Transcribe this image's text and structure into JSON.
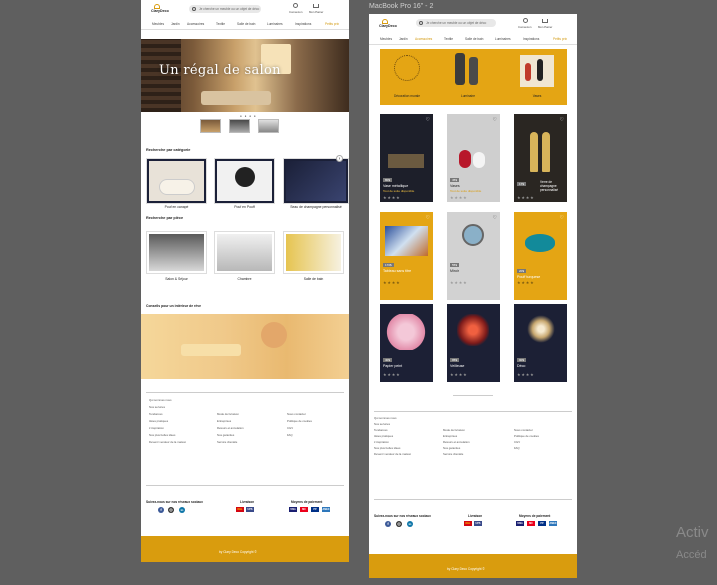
{
  "frame_title": "MacBook Pro 16\" - 2",
  "watermark": {
    "line1": "Activ",
    "line2": "Accéd"
  },
  "brand": "ClaryDeco",
  "search_placeholder": "Je cherche un meuble ou un objet de déco",
  "header": {
    "account": "Connexion",
    "cart": "Mon Panier"
  },
  "nav": [
    "Meubles",
    "Jardin",
    "Accessoires",
    "Textile",
    "Salle de bain",
    "Luminaires",
    "Inspirations",
    "Petits prix"
  ],
  "mobile": {
    "hero_title": "Un régal de salon",
    "dots": "● ● ● ●",
    "section_category": "Recherche par catégorie",
    "categories": [
      "Pouf en canapé",
      "Pouf en Pouff",
      "Seau de champagne personnalisé"
    ],
    "section_room": "Recherche par pièce",
    "rooms": [
      "Salon & Séjour",
      "Chambre",
      "Salle de bain"
    ],
    "promo_title": "Conseils pour un intérieur de rêve"
  },
  "desktop": {
    "banner": [
      "Décoration murale",
      "Luminaire",
      "Vases"
    ],
    "products": [
      {
        "price": "80$",
        "name": "Vase métallique",
        "link": "Tout de suite disponible"
      },
      {
        "price": "45$",
        "name": "Vases",
        "link": "Tout de suite disponible"
      },
      {
        "price": "17$",
        "name": "Verre de champagne personnalisé",
        "link": ""
      },
      {
        "price": "170$",
        "name": "Tableau sans titre",
        "link": ""
      },
      {
        "price": "55$",
        "name": "Miroir",
        "link": ""
      },
      {
        "price": "20$",
        "name": "Pouff turquese",
        "link": ""
      },
      {
        "price": "40$",
        "name": "Papier peint",
        "link": ""
      },
      {
        "price": "95$",
        "name": "Veilleuse",
        "link": ""
      },
      {
        "price": "90$",
        "name": "Déco",
        "link": ""
      }
    ]
  },
  "footer": {
    "col1": [
      "Qui sommes nous",
      "Nos services",
      "Tendances",
      "Idées pratiques",
      "L'inspiration",
      "Nos plus belles idées",
      "Devenir vendeur de la maison"
    ],
    "col2": [
      "Mode de livraison",
      "Entreprises",
      "Retours et annulation",
      "Nos garanties",
      "Service clientèle"
    ],
    "col3": [
      "Nous contacter",
      "Politique de cookies",
      "CGV",
      "FAQ"
    ],
    "social_title": "Suivez-nous sur nos réseaux sociaux",
    "delivery_title": "Livraison",
    "payment_title": "Moyens de paiement",
    "copyright": "by Clary Deco Copyright ©",
    "social": [
      "f",
      "◎",
      "in"
    ],
    "pay": [
      "VISA",
      "MC",
      "PP",
      "AMEX"
    ]
  },
  "colors": {
    "accent": "#d99c0e",
    "banner": "#e4a514",
    "dark_card": "#1c2035"
  }
}
